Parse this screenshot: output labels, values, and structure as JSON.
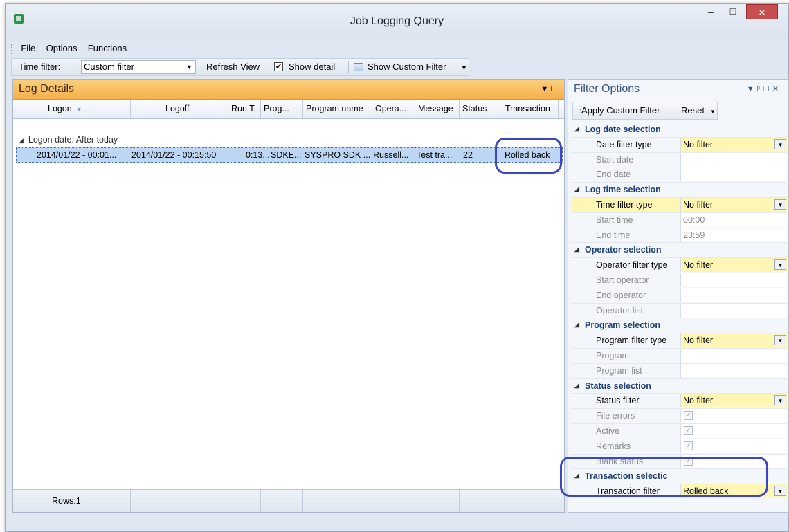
{
  "window": {
    "title": "Job Logging Query",
    "min_glyph": "–",
    "max_glyph": "☐",
    "close_glyph": "✕"
  },
  "menu": [
    "File",
    "Options",
    "Functions"
  ],
  "toolbar": {
    "time_filter_label": "Time filter:",
    "time_filter_value": "Custom filter",
    "refresh_label": "Refresh View",
    "show_detail_label": "Show detail",
    "show_detail_checked": "✔",
    "show_custom_filter_label": "Show Custom Filter"
  },
  "log_panel": {
    "title": "Log Details",
    "columns": [
      "Logon",
      "Logoff",
      "Run T...",
      "Prog...",
      "Program name",
      "Opera...",
      "Message",
      "Status",
      "Transaction"
    ],
    "group_label": "Logon date: After today",
    "row": [
      "2014/01/22 - 00:01...",
      "2014/01/22 - 00:15:50",
      "0:13...",
      "SDKE...",
      "SYSPRO SDK ...",
      "Russell...",
      "Test tra...",
      "22",
      "Rolled back"
    ],
    "footer_rows": "Rows:1"
  },
  "filter_panel": {
    "title": "Filter Options",
    "apply_label": "Apply Custom Filter",
    "reset_label": "Reset",
    "sections": [
      {
        "name": "Log date selection",
        "props": [
          {
            "name": "Date filter type",
            "value": "No filter",
            "enabled": true,
            "dropdown": true
          },
          {
            "name": "Start date",
            "value": "",
            "enabled": false
          },
          {
            "name": "End date",
            "value": "",
            "enabled": false
          }
        ]
      },
      {
        "name": "Log time selection",
        "props": [
          {
            "name": "Time filter type",
            "value": "No filter",
            "enabled": true,
            "dropdown": true,
            "selected": true
          },
          {
            "name": "Start time",
            "value": "00:00",
            "enabled": false
          },
          {
            "name": "End time",
            "value": "23:59",
            "enabled": false
          }
        ]
      },
      {
        "name": "Operator selection",
        "props": [
          {
            "name": "Operator filter type",
            "value": "No filter",
            "enabled": true,
            "dropdown": true
          },
          {
            "name": "Start operator",
            "value": "",
            "enabled": false
          },
          {
            "name": "End operator",
            "value": "",
            "enabled": false
          },
          {
            "name": "Operator list",
            "value": "",
            "enabled": false
          }
        ]
      },
      {
        "name": "Program selection",
        "props": [
          {
            "name": "Program filter type",
            "value": "No filter",
            "enabled": true,
            "dropdown": true
          },
          {
            "name": "Program",
            "value": "",
            "enabled": false
          },
          {
            "name": "Program list",
            "value": "",
            "enabled": false
          }
        ]
      },
      {
        "name": "Status selection",
        "props": [
          {
            "name": "Status filter",
            "value": "No filter",
            "enabled": true,
            "dropdown": true
          },
          {
            "name": "File errors",
            "value": "",
            "enabled": false,
            "checkbox": true
          },
          {
            "name": "Active",
            "value": "",
            "enabled": false,
            "checkbox": true
          },
          {
            "name": "Remarks",
            "value": "",
            "enabled": false,
            "checkbox": true
          },
          {
            "name": "Blank status",
            "value": "",
            "enabled": false,
            "checkbox": true
          }
        ]
      },
      {
        "name": "Transaction selectic",
        "props": [
          {
            "name": "Transaction filter",
            "value": "Rolled back",
            "enabled": true,
            "dropdown": true
          }
        ]
      }
    ]
  },
  "colors": {
    "accent_orange": "#f6b04a",
    "annotation_blue": "#3b47c2",
    "selection_blue": "#bcd6f3",
    "highlight_yellow": "#fdf6b4"
  }
}
